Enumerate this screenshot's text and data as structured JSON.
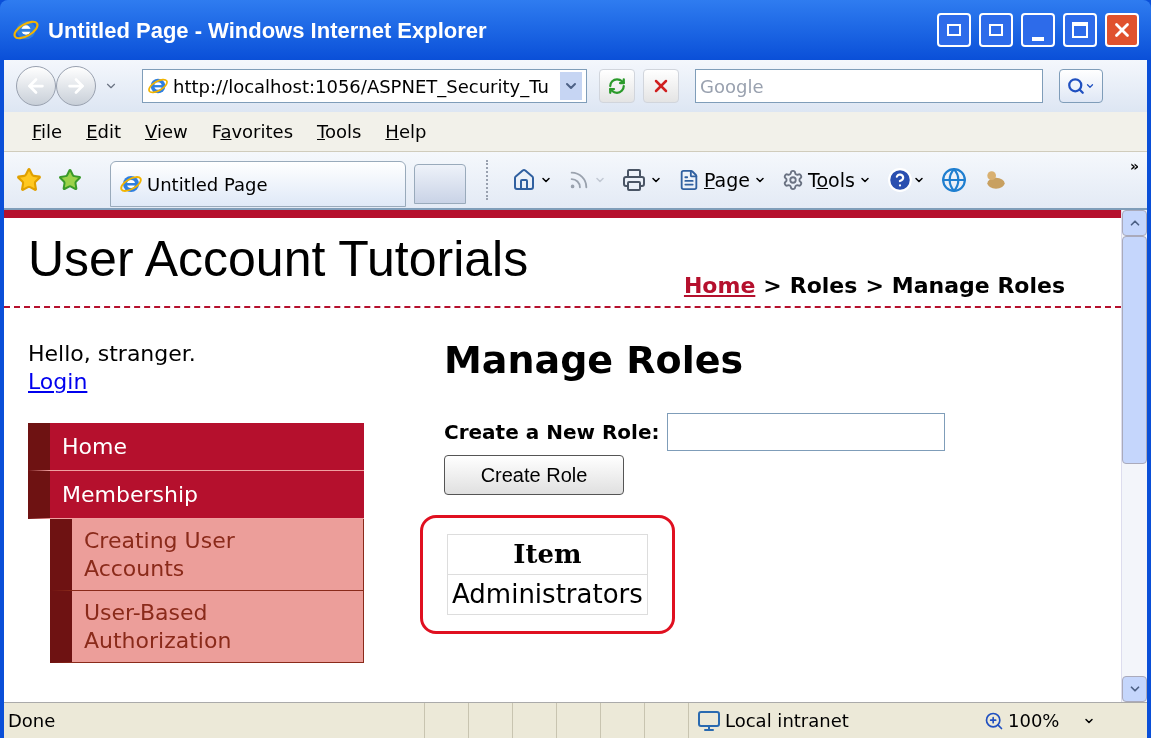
{
  "window": {
    "title": "Untitled Page - Windows Internet Explorer"
  },
  "address": {
    "url": "http://localhost:1056/ASPNET_Security_Tu"
  },
  "search": {
    "placeholder": "Google"
  },
  "menu": [
    {
      "key": "F",
      "rest": "ile"
    },
    {
      "key": "E",
      "rest": "dit"
    },
    {
      "key": "V",
      "rest": "iew"
    },
    {
      "pre": "F",
      "key": "a",
      "rest": "vorites"
    },
    {
      "key": "T",
      "rest": "ools"
    },
    {
      "key": "H",
      "rest": "elp"
    }
  ],
  "tabs": [
    {
      "label": "Untitled Page",
      "selected": true
    }
  ],
  "toolbar": [
    {
      "kind": "home"
    },
    {
      "kind": "feeds",
      "disabled": true
    },
    {
      "kind": "print"
    },
    {
      "kind": "page",
      "key": "P",
      "rest": "age"
    },
    {
      "kind": "tools",
      "pre": "T",
      "key": "o",
      "rest": "ols"
    },
    {
      "kind": "help"
    },
    {
      "kind": "research"
    },
    {
      "kind": "messenger"
    }
  ],
  "toolbar_overflow": "»",
  "page": {
    "site_title": "User Account Tutorials",
    "breadcrumb": [
      {
        "label": "Home",
        "kind": "link"
      },
      {
        "label": ">",
        "kind": "separator"
      },
      {
        "label": "Roles",
        "kind": "text"
      },
      {
        "label": ">",
        "kind": "separator"
      },
      {
        "label": "Manage Roles",
        "kind": "text"
      }
    ],
    "greeting": "Hello, stranger.",
    "login_link": "Login",
    "nav": [
      {
        "label": "Home"
      },
      {
        "label": "Membership",
        "children": [
          {
            "label": "Creating User Accounts"
          },
          {
            "label": "User-Based Authorization"
          }
        ]
      }
    ],
    "heading": "Manage Roles",
    "form": {
      "label": "Create a New Role:",
      "button": "Create Role"
    },
    "grid": {
      "highlighted": true,
      "columns": [
        "Item"
      ],
      "rows": [
        [
          "Administrators"
        ]
      ]
    }
  },
  "status_bar": {
    "text": "Done",
    "zone": "Local intranet",
    "zoom": "100%"
  }
}
